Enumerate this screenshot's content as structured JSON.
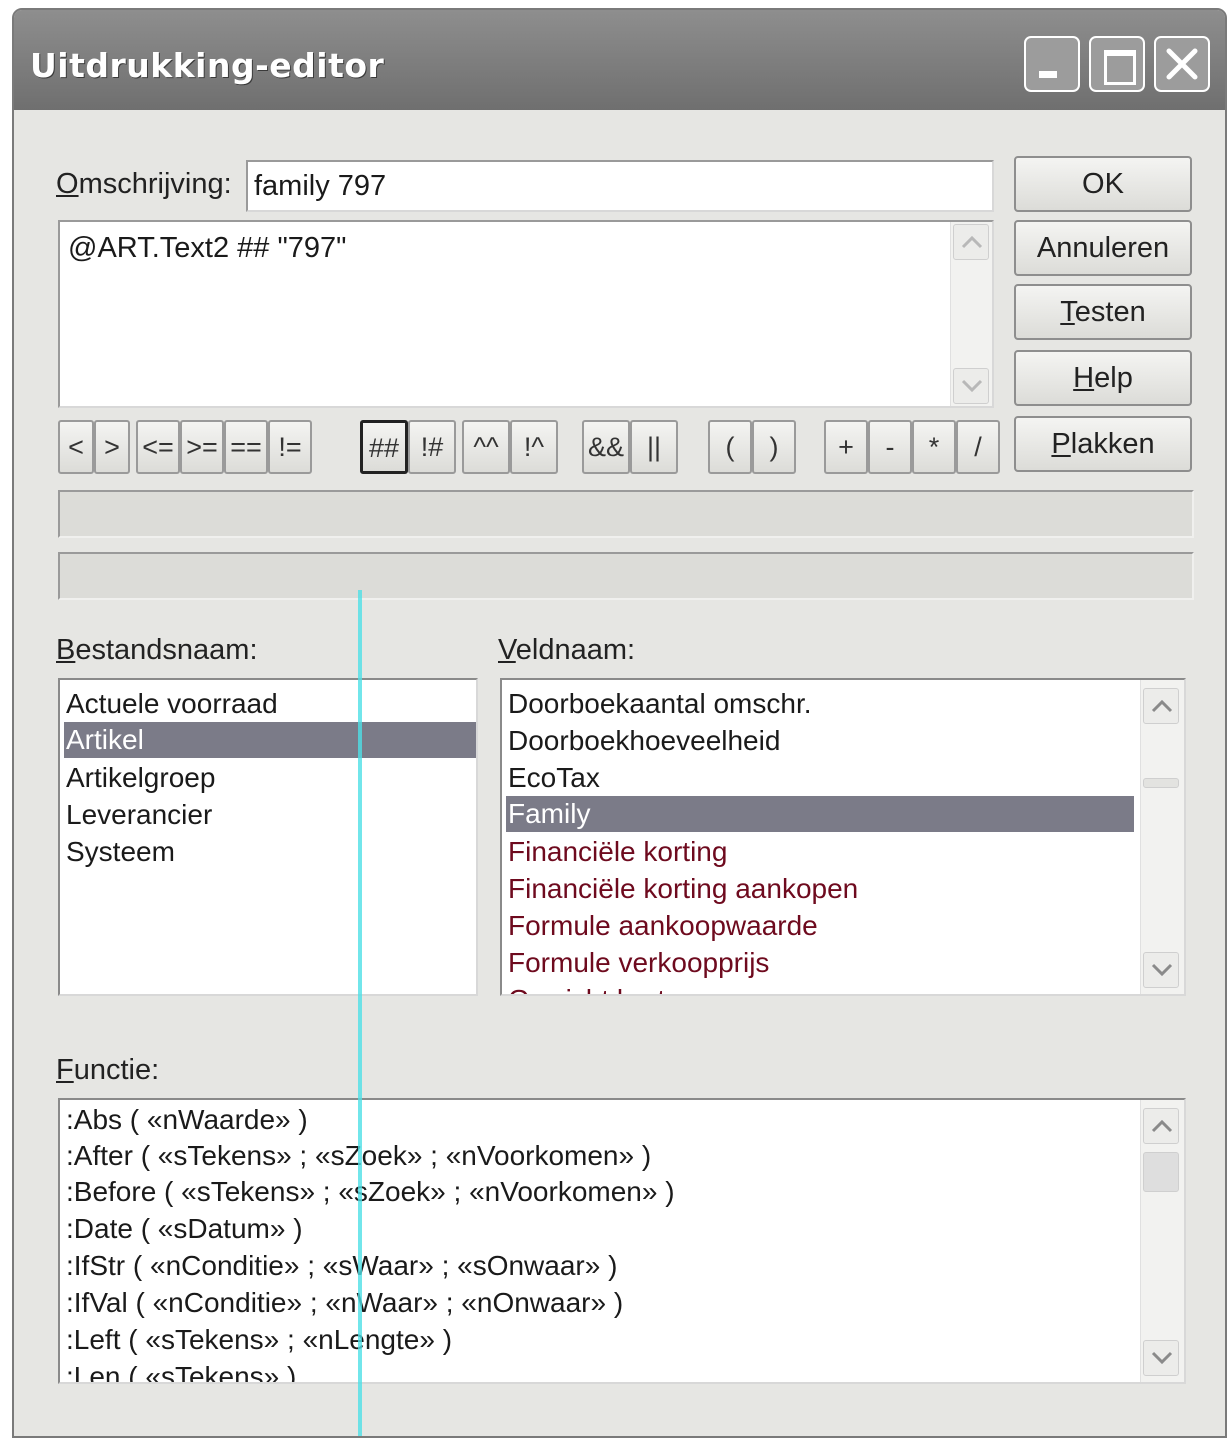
{
  "window": {
    "title": "Uitdrukking-editor"
  },
  "omschrijving": {
    "label_prefix": "",
    "label_underlined": "O",
    "label_rest": "mschrijving:",
    "value": "family 797"
  },
  "expression": {
    "value": "@ART.Text2 ## \"797\""
  },
  "buttons": {
    "ok": "OK",
    "annuleren": "Annuleren",
    "testen_u": "T",
    "testen_rest": "esten",
    "help_u": "H",
    "help_rest": "elp",
    "plakken_u": "P",
    "plakken_rest": "lakken"
  },
  "operators": [
    "<",
    ">",
    "<=",
    ">=",
    "==",
    "!=",
    "##",
    "!#",
    "^^",
    "!^",
    "&&",
    "||",
    "(",
    ")",
    "+",
    "-",
    "*",
    "/"
  ],
  "active_operator": "##",
  "bestandsnaam": {
    "label_u": "B",
    "label_rest": "estandsnaam:",
    "items": [
      "Actuele voorraad",
      "Artikel",
      "Artikelgroep",
      "Leverancier",
      "Systeem"
    ],
    "selected": "Artikel"
  },
  "veldnaam": {
    "label_u": "V",
    "label_rest": "eldnaam:",
    "items": [
      "Doorboekaantal omschr.",
      "Doorboekhoeveelheid",
      "EcoTax",
      "Family",
      "Financiële korting",
      "Financiële korting aankopen",
      "Formule aankoopwaarde",
      "Formule verkoopprijs",
      "Gewicht bruto"
    ],
    "selected": "Family"
  },
  "functie": {
    "label_u": "F",
    "label_rest": "unctie:",
    "items": [
      ":Abs ( «nWaarde» )",
      ":After ( «sTekens» ; «sZoek» ; «nVoorkomen» )",
      ":Before ( «sTekens» ; «sZoek» ; «nVoorkomen» )",
      ":Date ( «sDatum» )",
      ":IfStr ( «nConditie» ; «sWaar» ; «sOnwaar» )",
      ":IfVal ( «nConditie» ; «nWaar» ; «nOnwaar» )",
      ":Left ( «sTekens» ; «nLengte» )",
      ":Len ( «sTekens» )"
    ]
  },
  "icons": {
    "minimize": "minimize-icon",
    "maximize": "maximize-icon",
    "close": "close-icon",
    "scroll_up": "chevron-up-icon",
    "scroll_down": "chevron-down-icon"
  }
}
